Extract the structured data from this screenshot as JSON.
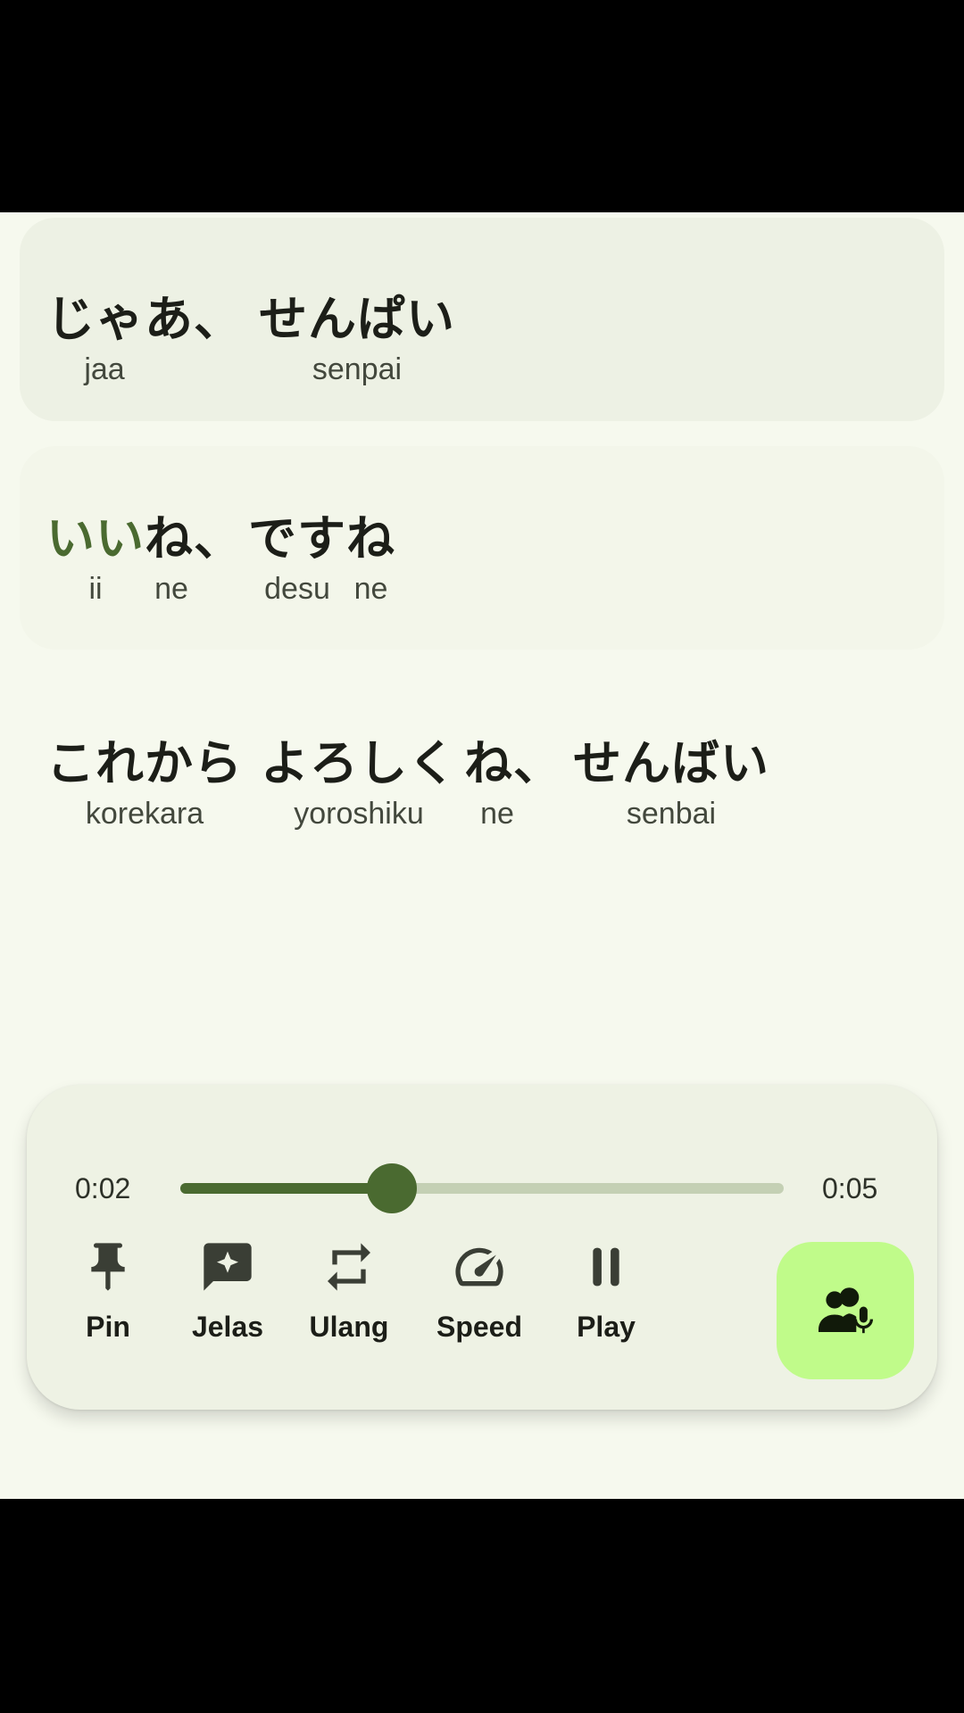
{
  "lines": [
    {
      "words": [
        {
          "jp": "じゃあ、",
          "romaji": "jaa"
        },
        {
          "jp": "せんぱい",
          "romaji": "senpai"
        }
      ]
    },
    {
      "words": [
        {
          "jp": "いい",
          "romaji": "ii",
          "highlight": true
        },
        {
          "jp": "ね、",
          "romaji": "ne"
        },
        {
          "jp": "です",
          "romaji": "desu"
        },
        {
          "jp": "ね",
          "romaji": "ne"
        }
      ]
    },
    {
      "words": [
        {
          "jp": "これから",
          "romaji": "korekara"
        },
        {
          "jp": "よろしく",
          "romaji": "yoroshiku"
        },
        {
          "jp": "ね、",
          "romaji": "ne"
        },
        {
          "jp": "せんばい",
          "romaji": "senbai"
        }
      ]
    }
  ],
  "player": {
    "current_time": "0:02",
    "total_time": "0:05",
    "progress_fraction": 0.35,
    "controls": {
      "pin": {
        "label": "Pin",
        "icon": "pin-icon"
      },
      "explain": {
        "label": "Jelas",
        "icon": "ai-comment-icon"
      },
      "repeat": {
        "label": "Ulang",
        "icon": "repeat-icon"
      },
      "speed": {
        "label": "Speed",
        "icon": "speedometer-icon"
      },
      "play": {
        "label": "Play",
        "icon": "pause-icon"
      }
    },
    "voice_button_icon": "voice-people-icon"
  },
  "colors": {
    "accent": "#4a6a30",
    "accent_light": "#c0fb8a",
    "track": "#c4d0b4",
    "background": "#f6f9ee"
  }
}
